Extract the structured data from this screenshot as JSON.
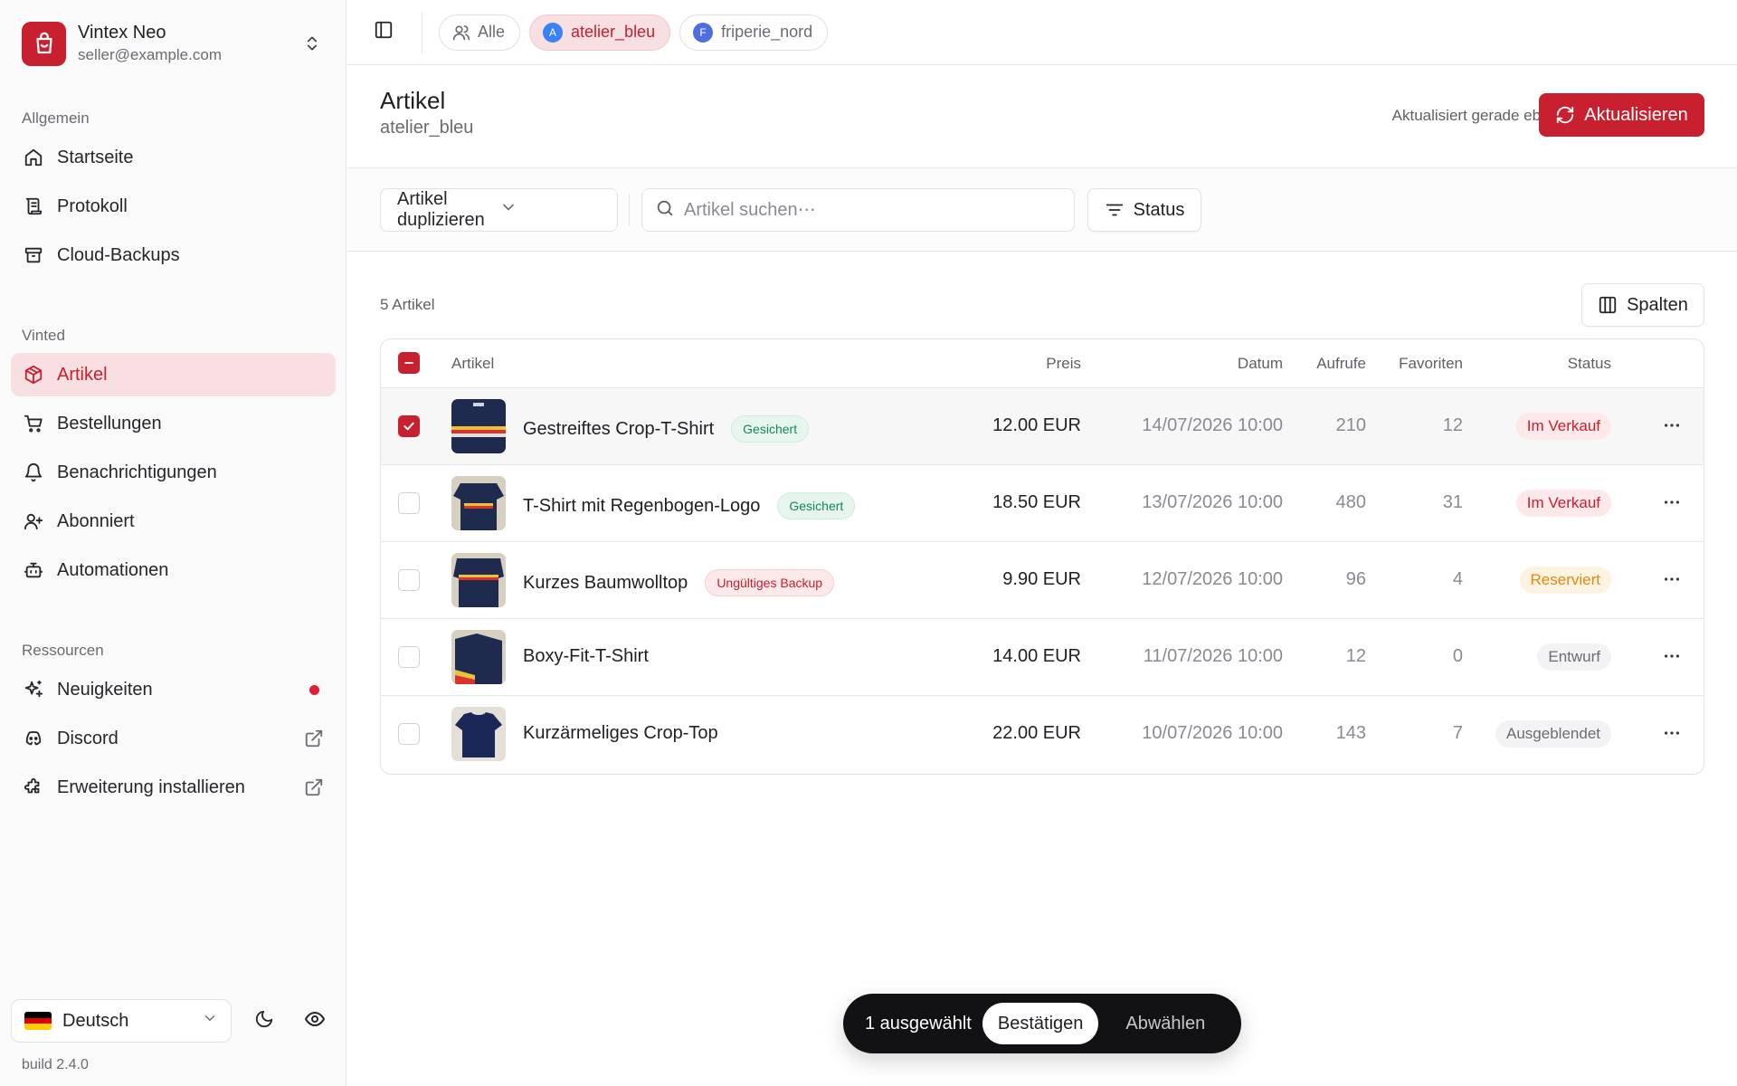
{
  "account": {
    "name": "Vintex Neo",
    "email": "seller@example.com"
  },
  "nav": {
    "general_heading": "Allgemein",
    "general": [
      {
        "label": "Startseite"
      },
      {
        "label": "Protokoll"
      },
      {
        "label": "Cloud-Backups"
      }
    ],
    "vinted_heading": "Vinted",
    "vinted": [
      {
        "label": "Artikel"
      },
      {
        "label": "Bestellungen"
      },
      {
        "label": "Benachrichtigungen"
      },
      {
        "label": "Abonniert"
      },
      {
        "label": "Automationen"
      }
    ],
    "resources_heading": "Ressourcen",
    "resources": [
      {
        "label": "Neuigkeiten"
      },
      {
        "label": "Discord"
      },
      {
        "label": "Erweiterung installieren"
      }
    ]
  },
  "footer": {
    "language": "Deutsch",
    "build": "build 2.4.0"
  },
  "topbar": {
    "chips": [
      {
        "label": "Alle"
      },
      {
        "label": "atelier_bleu",
        "initial": "A"
      },
      {
        "label": "friperie_nord",
        "initial": "F"
      }
    ]
  },
  "header": {
    "title": "Artikel",
    "subtitle": "atelier_bleu",
    "updated": "Aktualisiert gerade eben",
    "refresh_label": "Aktualisieren"
  },
  "filters": {
    "action_select": "Artikel duplizieren",
    "search_placeholder": "Artikel suchen⋯",
    "status_label": "Status"
  },
  "content": {
    "count": "5 Artikel",
    "columns_label": "Spalten"
  },
  "table": {
    "headers": {
      "item": "Artikel",
      "price": "Preis",
      "date": "Datum",
      "views": "Aufrufe",
      "favorites": "Favoriten",
      "status": "Status"
    },
    "rows": [
      {
        "title": "Gestreiftes Crop-T-Shirt",
        "badge": "Gesichert",
        "price": "12.00 EUR",
        "date": "14/07/2026 10:00",
        "views": "210",
        "favorites": "12",
        "status": "Im Verkauf"
      },
      {
        "title": "T-Shirt mit Regenbogen-Logo",
        "badge": "Gesichert",
        "price": "18.50 EUR",
        "date": "13/07/2026 10:00",
        "views": "480",
        "favorites": "31",
        "status": "Im Verkauf"
      },
      {
        "title": "Kurzes Baumwolltop",
        "badge": "Ungültiges Backup",
        "price": "9.90 EUR",
        "date": "12/07/2026 10:00",
        "views": "96",
        "favorites": "4",
        "status": "Reserviert"
      },
      {
        "title": "Boxy-Fit-T-Shirt",
        "price": "14.00 EUR",
        "date": "11/07/2026 10:00",
        "views": "12",
        "favorites": "0",
        "status": "Entwurf"
      },
      {
        "title": "Kurzärmeliges Crop-Top",
        "price": "22.00 EUR",
        "date": "10/07/2026 10:00",
        "views": "143",
        "favorites": "7",
        "status": "Ausgeblendet"
      }
    ]
  },
  "selection": {
    "count": "1 ausgewählt",
    "confirm": "Bestätigen",
    "deselect": "Abwählen"
  },
  "colors": {
    "brand": "#c8202f",
    "success": "#14875a",
    "warning": "#e08a12"
  }
}
